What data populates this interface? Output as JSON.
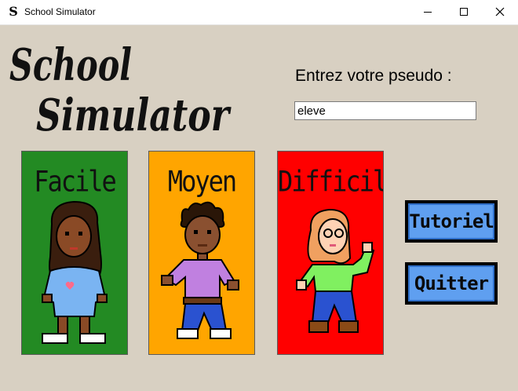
{
  "window": {
    "title": "School Simulator",
    "app_icon": "S",
    "controls": [
      "minimize-icon",
      "maximize-icon",
      "close-icon"
    ]
  },
  "logo": {
    "line1": "School",
    "line2": "Simulator"
  },
  "pseudo": {
    "prompt": "Entrez votre pseudo :",
    "value": "eleve"
  },
  "difficulties": [
    {
      "label": "Facile",
      "color": "#238a23"
    },
    {
      "label": "Moyen",
      "color": "#ffa500"
    },
    {
      "label": "Difficile",
      "color": "#ff0000"
    }
  ],
  "buttons": {
    "tutorial": "Tutoriel",
    "quit": "Quitter",
    "color": "#5f9ff0"
  }
}
